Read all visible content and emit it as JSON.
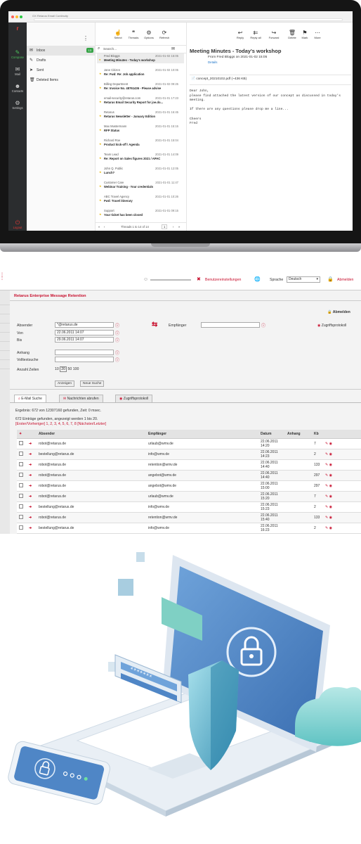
{
  "webmail": {
    "tab_title": "OX Retarus Email Continuity",
    "nav": {
      "compose": "Compose",
      "mail": "Mail",
      "contacts": "Contacts",
      "settings": "Settings",
      "logout": "Logout"
    },
    "folders": [
      {
        "label": "Inbox",
        "count": "13"
      },
      {
        "label": "Drafts"
      },
      {
        "label": "Sent"
      },
      {
        "label": "Deleted Items"
      }
    ],
    "toolbar": {
      "select": "Select",
      "threads": "Threads",
      "options": "Options",
      "refresh": "Refresh",
      "reply": "Reply",
      "reply_all": "Reply all",
      "forward": "Forward",
      "delete": "Delete",
      "mark": "Mark",
      "more": "More"
    },
    "search_placeholder": "Search...",
    "messages": [
      {
        "from": "Fred Bloggs",
        "date": "2021-01-02 15:05",
        "subject": "Meeting Minutes - Today's workshop"
      },
      {
        "from": "Jane Citizen",
        "date": "2021-01-02 10:05",
        "subject": "Re: Fwd: Re: Job application"
      },
      {
        "from": "Billing Department",
        "date": "2021-01-02 09:25",
        "subject": "Re: Invoice No. 48761436 - Please advise"
      },
      {
        "from": "email-security@retarus.com",
        "date": "2021-01-01 17:23",
        "subject": "Retarus Email Security Report for joe.do..."
      },
      {
        "from": "Retarus",
        "date": "2021-01-01 16:45",
        "subject": "Retarus Newsletter - January Edition"
      },
      {
        "from": "Max Mustermann",
        "date": "2021-01-01 15:15",
        "subject": "RFP Status"
      },
      {
        "from": "Richard Roe",
        "date": "2021-01-01 15:04",
        "subject": "Product kick-off / Agenda"
      },
      {
        "from": "Team Lead",
        "date": "2021-01-01 14:09",
        "subject": "Re: Report on Sales figures 2021 / APAC"
      },
      {
        "from": "John Q. Public",
        "date": "2021-01-01 12:05",
        "subject": "Lunch?"
      },
      {
        "from": "Customer Care",
        "date": "2021-01-01 11:47",
        "subject": "Webinar Training - Your credentials"
      },
      {
        "from": "ABC Travel Agency",
        "date": "2021-01-01 10:26",
        "subject": "Fwd: Travel itinerary"
      },
      {
        "from": "Support",
        "date": "2021-01-01 09:15",
        "subject": "Your ticket has been closed"
      }
    ],
    "pager": {
      "label": "Threads 1 to 14 of 14",
      "page": "1"
    },
    "reading": {
      "subject": "Meeting Minutes - Today's workshop",
      "from_line": "From Fred Bloggs on 2021-01-02 15:05",
      "details": "Details",
      "attachment": "concept_20210102.pdf (~436 KB)",
      "body": [
        "Dear John,",
        "please find attached the latest version of our concept as discussed in today's",
        "meeting.",
        "",
        "If there are any questions please drop me a line...",
        "",
        "Cheers",
        "Fred"
      ]
    }
  },
  "retention": {
    "header": {
      "settings": "Benutzereinstellungen",
      "language_label": "Sprache",
      "language": "Deutsch",
      "logout": "Abmelden"
    },
    "title": "Retarus Enterprise Message Retention",
    "abmelden": "Abmelden",
    "form": {
      "sender_label": "Absender",
      "sender_value": "*@retarus.de",
      "from_label": "Von",
      "from_value": "22.06.2011 14:07",
      "to_label": "Bis",
      "to_value": "29.06.2011 14:07",
      "recipient_label": "Empfänger",
      "access_log": "Zugriffsprotokoll",
      "attachment_label": "Anhang",
      "fulltext_label": "Volltextsuche",
      "rows_label": "Anzahl Zeilen",
      "rows_options": [
        "10",
        "20",
        "50",
        "100"
      ],
      "show_button": "Anzeigen",
      "new_search_button": "Neue Suche"
    },
    "tabs": [
      "E-Mail Suche",
      "Nachrichten abrufen",
      "Zugriffsprotokoll"
    ],
    "result_line": "Ergebnis: 672 von 12307160 gefunden, Zeit: 0 msec.",
    "found_line": "672 Einträge gefunden, angezeigt werden 1 bis 20.",
    "pager_line": "[Erster/Vorheriger] 1, 2, 3, 4, 5, 6, 7, 8 [Nächster/Letzter]",
    "columns": [
      "Absender",
      "Empfänger",
      "Datum",
      "Anhang",
      "Kb"
    ],
    "rows": [
      {
        "sender": "robot@retarus.de",
        "recipient": "urlaub@wmv.de",
        "date": "22.06.2011",
        "time": "14:20",
        "kb": "7"
      },
      {
        "sender": "bestellung@retarus.de",
        "recipient": "info@wmv.de",
        "date": "22.06.2011",
        "time": "14:23",
        "kb": "2"
      },
      {
        "sender": "robot@retarus.de",
        "recipient": "retention@wmv.de",
        "date": "22.06.2011",
        "time": "14:40",
        "kb": "133"
      },
      {
        "sender": "robot@retarus.de",
        "recipient": "angebot@wmv.de",
        "date": "22.06.2011",
        "time": "14:40",
        "kb": "297"
      },
      {
        "sender": "robot@retarus.de",
        "recipient": "angebot@wmv.de",
        "date": "22.06.2011",
        "time": "15:00",
        "kb": "297"
      },
      {
        "sender": "robot@retarus.de",
        "recipient": "urlaub@wmv.de",
        "date": "22.06.2011",
        "time": "15:20",
        "kb": "7"
      },
      {
        "sender": "bestellung@retarus.de",
        "recipient": "info@wmv.de",
        "date": "22.06.2011",
        "time": "15:23",
        "kb": "2"
      },
      {
        "sender": "robot@retarus.de",
        "recipient": "retention@wmv.de",
        "date": "22.06.2011",
        "time": "15:40",
        "kb": "133"
      },
      {
        "sender": "bestellung@retarus.de",
        "recipient": "info@wmv.de",
        "date": "22.06.2011",
        "time": "16:23",
        "kb": "2"
      }
    ]
  },
  "illustration": {
    "colors": {
      "screen": "#4f86c6",
      "shield": "#6fb8d6",
      "cloud": "#8fd3d3",
      "laptop": "#eef3f8"
    }
  }
}
